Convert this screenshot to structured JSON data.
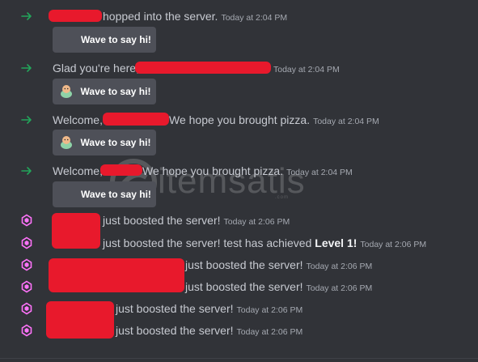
{
  "messages": {
    "m1": {
      "text": "hopped into the server.",
      "time": "Today at 2:04 PM"
    },
    "m2": {
      "prefix": "Glad you're here,",
      "time": "Today at 2:04 PM"
    },
    "m3": {
      "prefix": "Welcome,",
      "text": "We hope you brought pizza.",
      "time": "Today at 2:04 PM"
    },
    "m4": {
      "prefix": "Welcome,",
      "text": "We hope you brought pizza.",
      "time": "Today at 2:04 PM"
    },
    "b1": {
      "text": "just boosted the server!",
      "time": "Today at 2:06 PM"
    },
    "b2": {
      "text": "just boosted the server! test has achieved",
      "level": "Level 1!",
      "time": "Today at 2:06 PM"
    },
    "b3": {
      "text": "just boosted the server!",
      "time": "Today at 2:06 PM"
    },
    "b4": {
      "text": "just boosted the server!",
      "time": "Today at 2:06 PM"
    },
    "b5": {
      "text": "just boosted the server!",
      "time": "Today at 2:06 PM"
    },
    "b6": {
      "text": "just boosted the server!",
      "time": "Today at 2:06 PM"
    }
  },
  "wave_button": {
    "label": "Wave to say hi!"
  },
  "icons": {
    "join": "arrow-right-icon",
    "boost": "nitro-boost-gem-icon",
    "wave": "wave-sticker-icon"
  },
  "colors": {
    "background": "#313338",
    "join_arrow": "#23a55a",
    "boost_gem": "#ff73fa",
    "redaction": "#e8192c",
    "button": "#4e5058"
  }
}
